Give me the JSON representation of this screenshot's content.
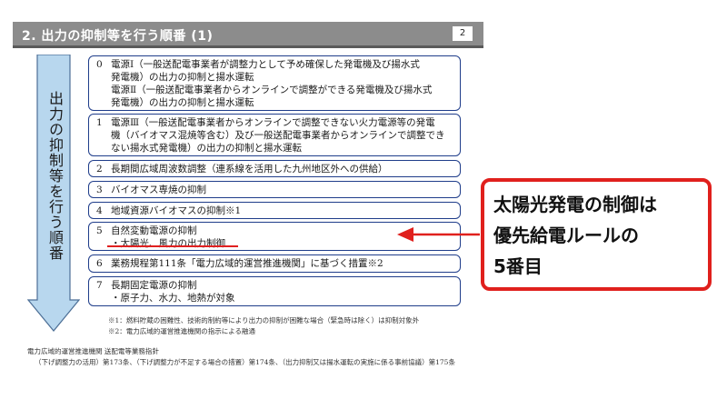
{
  "header": {
    "title": "2. 出力の抑制等を行う順番 (1)",
    "page_number": "2"
  },
  "arrow_label": "出力の抑制等を行う順番",
  "items": [
    {
      "num": "0",
      "lines": [
        "電源Ⅰ（一般送配電事業者が調整力として予め確保した発電機及び揚水式",
        "発電機）の出力の抑制と揚水運転",
        "電源Ⅱ（一般送配電事業者からオンラインで調整ができる発電機及び揚水式",
        "発電機）の出力の抑制と揚水運転"
      ]
    },
    {
      "num": "1",
      "lines": [
        "電源Ⅲ（一般送配電事業者からオンラインで調整できない火力電源等の発電",
        "機（バイオマス混焼等含む）及び一般送配電事業者からオンラインで調整でき",
        "ない揚水式発電機）の出力の抑制と揚水運転"
      ]
    },
    {
      "num": "2",
      "lines": [
        "長期間広域周波数調整（連系線を活用した九州地区外への供給）"
      ]
    },
    {
      "num": "3",
      "lines": [
        "バイオマス専焼の抑制"
      ]
    },
    {
      "num": "4",
      "lines": [
        "地域資源バイオマスの抑制※1"
      ]
    },
    {
      "num": "5",
      "lines": [
        "自然変動電源の抑制",
        "・太陽光、風力の出力制御"
      ]
    },
    {
      "num": "6",
      "lines": [
        "業務規程第111条「電力広域的運営推進機関」に基づく措置※2"
      ]
    },
    {
      "num": "7",
      "lines": [
        "長期固定電源の抑制",
        "・原子力、水力、地熱が対象"
      ]
    }
  ],
  "notes": [
    "※1：燃料貯蔵の困難性、技術的制約等により出力の抑制が困難な場合（緊急時は除く）は抑制対象外",
    "※2：電力広域的運営推進機関の指示による融通"
  ],
  "footer": [
    "電力広域的運営推進機関 送配電等業務指針",
    "（下げ調整力の活用）第173条、（下げ調整力が不足する場合の措置）第174条、（出力抑制又は揚水運転の実施に係る事前協議）第175条"
  ],
  "callout": {
    "lines": [
      "太陽光発電の制御は",
      "優先給電ルールの",
      "5番目"
    ]
  },
  "colors": {
    "header_bg": "#8c8c8c",
    "box_border": "#1f3d8a",
    "arrow_fill": "#b8d7ee",
    "highlight": "#e0201d"
  }
}
